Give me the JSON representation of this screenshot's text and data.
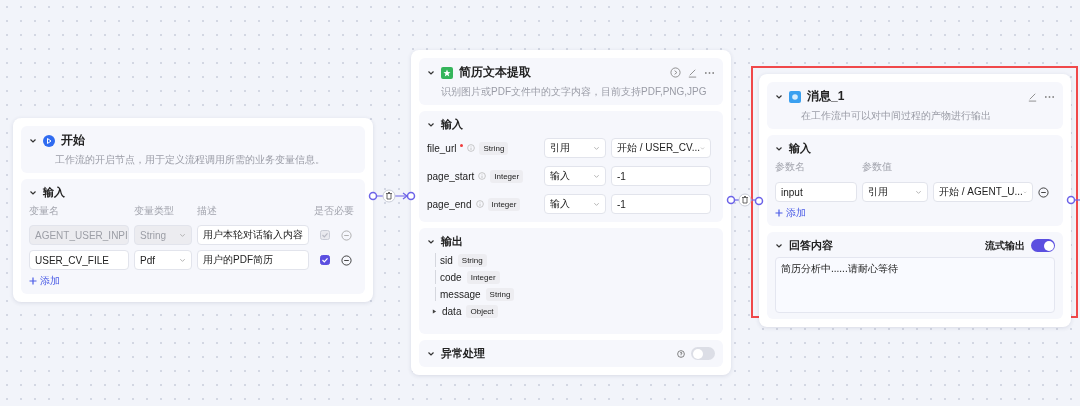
{
  "start_node": {
    "title": "开始",
    "description": "工作流的开启节点，用于定义流程调用所需的业务变量信息。",
    "input": {
      "title": "输入",
      "columns": [
        "变量名",
        "变量类型",
        "描述",
        "是否必要"
      ],
      "rows": [
        {
          "name": "AGENT_USER_INPI",
          "type": "String",
          "description": "用户本轮对话输入内容",
          "required": true,
          "disabled": true
        },
        {
          "name": "USER_CV_FILE",
          "type": "Pdf",
          "description": "用户的PDF简历",
          "required": true,
          "disabled": false
        }
      ],
      "add": "添加"
    }
  },
  "extract_node": {
    "title": "简历文本提取",
    "description": "识别图片或PDF文件中的文字内容，目前支持PDF,PNG,JPG",
    "input": {
      "title": "输入",
      "params": [
        {
          "name": "file_url",
          "required": true,
          "type": "String",
          "mode": "引用",
          "value": "开始 / USER_CV...",
          "kind": "select"
        },
        {
          "name": "page_start",
          "required": false,
          "type": "Integer",
          "mode": "输入",
          "value": "-1",
          "kind": "input"
        },
        {
          "name": "page_end",
          "required": false,
          "type": "Integer",
          "mode": "输入",
          "value": "-1",
          "kind": "input"
        }
      ]
    },
    "output": {
      "title": "输出",
      "fields": [
        {
          "name": "sid",
          "type": "String",
          "kind": "leaf"
        },
        {
          "name": "code",
          "type": "Integer",
          "kind": "leaf"
        },
        {
          "name": "message",
          "type": "String",
          "kind": "leaf"
        },
        {
          "name": "data",
          "type": "Object",
          "kind": "object"
        }
      ]
    },
    "error_handling": {
      "title": "异常处理",
      "on": false
    }
  },
  "message_node": {
    "title": "消息_1",
    "description": "在工作流中可以对中间过程的产物进行输出",
    "highlighted": true,
    "input": {
      "title": "输入",
      "columns": [
        "参数名",
        "参数值"
      ],
      "params": [
        {
          "name": "input",
          "mode": "引用",
          "value": "开始 / AGENT_U..."
        }
      ],
      "add": "添加"
    },
    "answer": {
      "title": "回答内容",
      "stream_label": "流式输出",
      "stream_on": true,
      "text": "简历分析中......请耐心等待"
    }
  }
}
